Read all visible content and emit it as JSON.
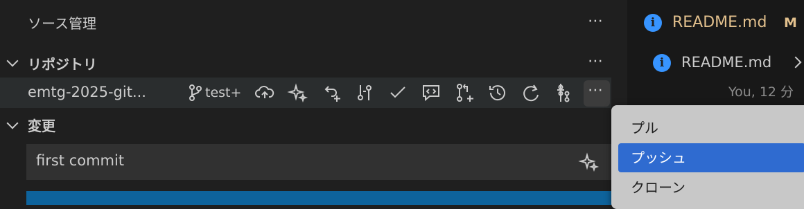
{
  "sidebar": {
    "title": "ソース管理",
    "repositories_header": "リポジトリ",
    "repo": {
      "name": "emtg-2025-git...",
      "branch": "test+"
    },
    "changes_header": "変更",
    "commit_input": {
      "value": "first commit"
    }
  },
  "editor": {
    "tab": {
      "title": "README.md",
      "status": "M"
    },
    "breadcrumb": "README.md",
    "blame": "You, 12 分"
  },
  "context_menu": {
    "items": [
      "プル",
      "プッシュ",
      "クローン"
    ],
    "selected": "プッシュ"
  },
  "colors": {
    "accent": "#3794ff",
    "menu_selected": "#2f6bd0",
    "modified": "#e2c08d"
  }
}
